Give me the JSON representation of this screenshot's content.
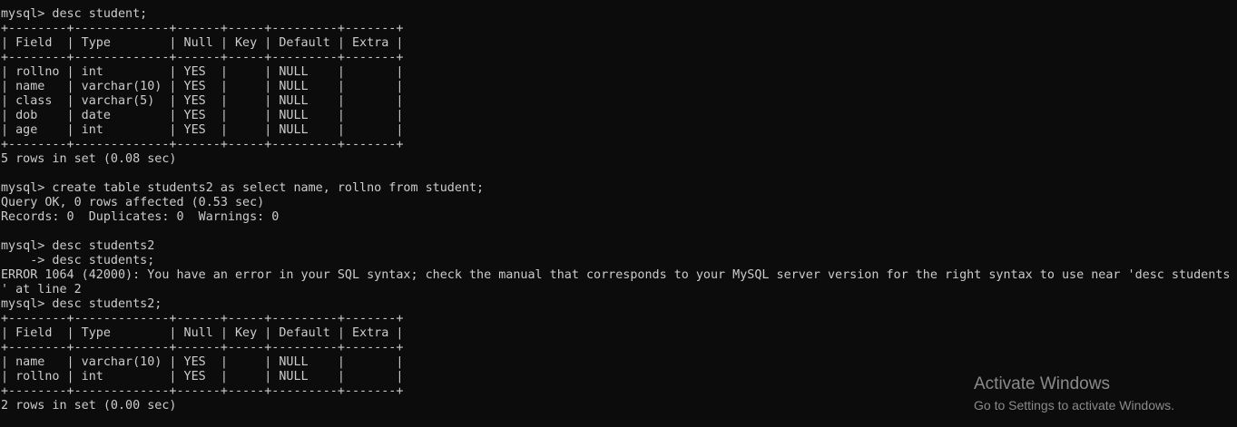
{
  "console": {
    "lines": [
      "mysql> desc student;",
      "+--------+-------------+------+-----+---------+-------+",
      "| Field  | Type        | Null | Key | Default | Extra |",
      "+--------+-------------+------+-----+---------+-------+",
      "| rollno | int         | YES  |     | NULL    |       |",
      "| name   | varchar(10) | YES  |     | NULL    |       |",
      "| class  | varchar(5)  | YES  |     | NULL    |       |",
      "| dob    | date        | YES  |     | NULL    |       |",
      "| age    | int         | YES  |     | NULL    |       |",
      "+--------+-------------+------+-----+---------+-------+",
      "5 rows in set (0.08 sec)",
      "",
      "mysql> create table students2 as select name, rollno from student;",
      "Query OK, 0 rows affected (0.53 sec)",
      "Records: 0  Duplicates: 0  Warnings: 0",
      "",
      "mysql> desc students2",
      "    -> desc students;",
      "ERROR 1064 (42000): You have an error in your SQL syntax; check the manual that corresponds to your MySQL server version for the right syntax to use near 'desc students",
      "' at line 2",
      "mysql> desc students2;",
      "+--------+-------------+------+-----+---------+-------+",
      "| Field  | Type        | Null | Key | Default | Extra |",
      "+--------+-------------+------+-----+---------+-------+",
      "| name   | varchar(10) | YES  |     | NULL    |       |",
      "| rollno | int         | YES  |     | NULL    |       |",
      "+--------+-------------+------+-----+---------+-------+",
      "2 rows in set (0.00 sec)"
    ]
  },
  "watermark": {
    "title": "Activate Windows",
    "subtitle": "Go to Settings to activate Windows."
  },
  "colors": {
    "background": "#0c0c0c",
    "text": "#cccccc",
    "watermark": "#8a8a8a"
  }
}
